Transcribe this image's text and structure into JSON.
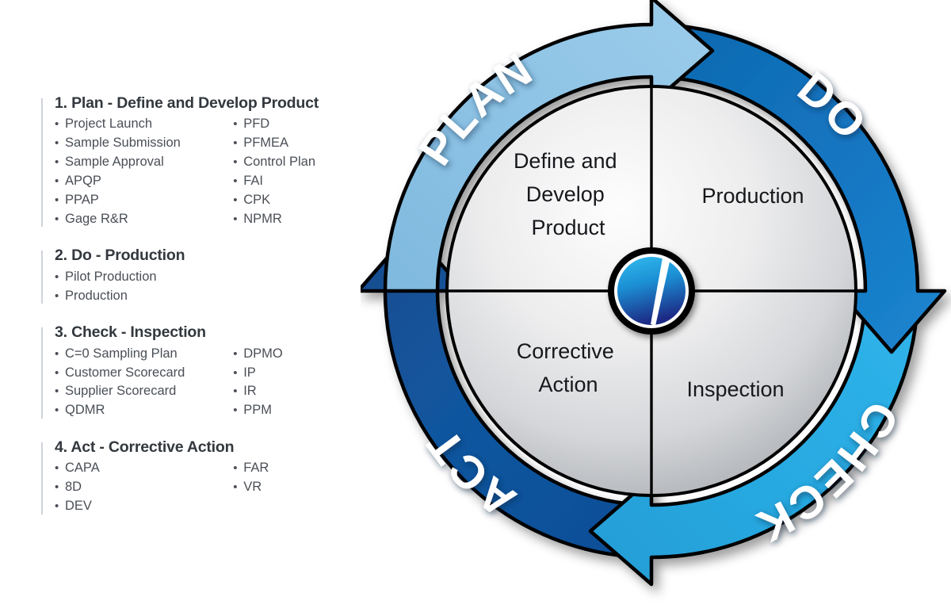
{
  "checklist": {
    "sections": [
      {
        "title": "1. Plan - Define and Develop Product",
        "col1": [
          "Project Launch",
          "Sample Submission",
          "Sample Approval",
          "APQP",
          "PPAP",
          "Gage R&R"
        ],
        "col2": [
          "PFD",
          "PFMEA",
          "Control Plan",
          "FAI",
          "CPK",
          "NPMR"
        ]
      },
      {
        "title": "2. Do - Production",
        "col1": [
          "Pilot Production",
          "Production"
        ],
        "col2": []
      },
      {
        "title": "3. Check - Inspection",
        "col1": [
          "C=0 Sampling Plan",
          "Customer Scorecard",
          "Supplier Scorecard",
          "QDMR"
        ],
        "col2": [
          "DPMO",
          "IP",
          "IR",
          "PPM"
        ]
      },
      {
        "title": "4. Act - Corrective Action",
        "col1": [
          "CAPA",
          "8D",
          "DEV"
        ],
        "col2": [
          "FAR",
          "VR"
        ]
      }
    ],
    "bullet_glyph": "•"
  },
  "cycle": {
    "segments": [
      {
        "key": "plan",
        "word": "PLAN",
        "color": "#8CC1E3",
        "color_dark": "#6FAFD8"
      },
      {
        "key": "do",
        "word": "DO",
        "color": "#1273BE",
        "color_dark": "#0E5E9E"
      },
      {
        "key": "check",
        "word": "CHECK",
        "color": "#29ABE2",
        "color_dark": "#1E93C6"
      },
      {
        "key": "act",
        "word": "ACT",
        "color": "#10539D",
        "color_dark": "#0C4383"
      }
    ],
    "quadrants": [
      {
        "key": "plan",
        "lines": [
          "Define and",
          "Develop",
          "Product"
        ]
      },
      {
        "key": "do",
        "lines": [
          "Production"
        ]
      },
      {
        "key": "check",
        "lines": [
          "Inspection"
        ]
      },
      {
        "key": "act",
        "lines": [
          "Corrective",
          "Action"
        ]
      }
    ],
    "hub": {
      "name": "hub-logo"
    },
    "colors": {
      "outline": "#000000",
      "disc_light": "#fbfbfc",
      "disc_mid": "#e3e4e6",
      "disc_edge": "#aeb1b5",
      "hub_top": "#2EB3E8",
      "hub_bottom": "#1B2E84",
      "text": "#16181b"
    }
  }
}
